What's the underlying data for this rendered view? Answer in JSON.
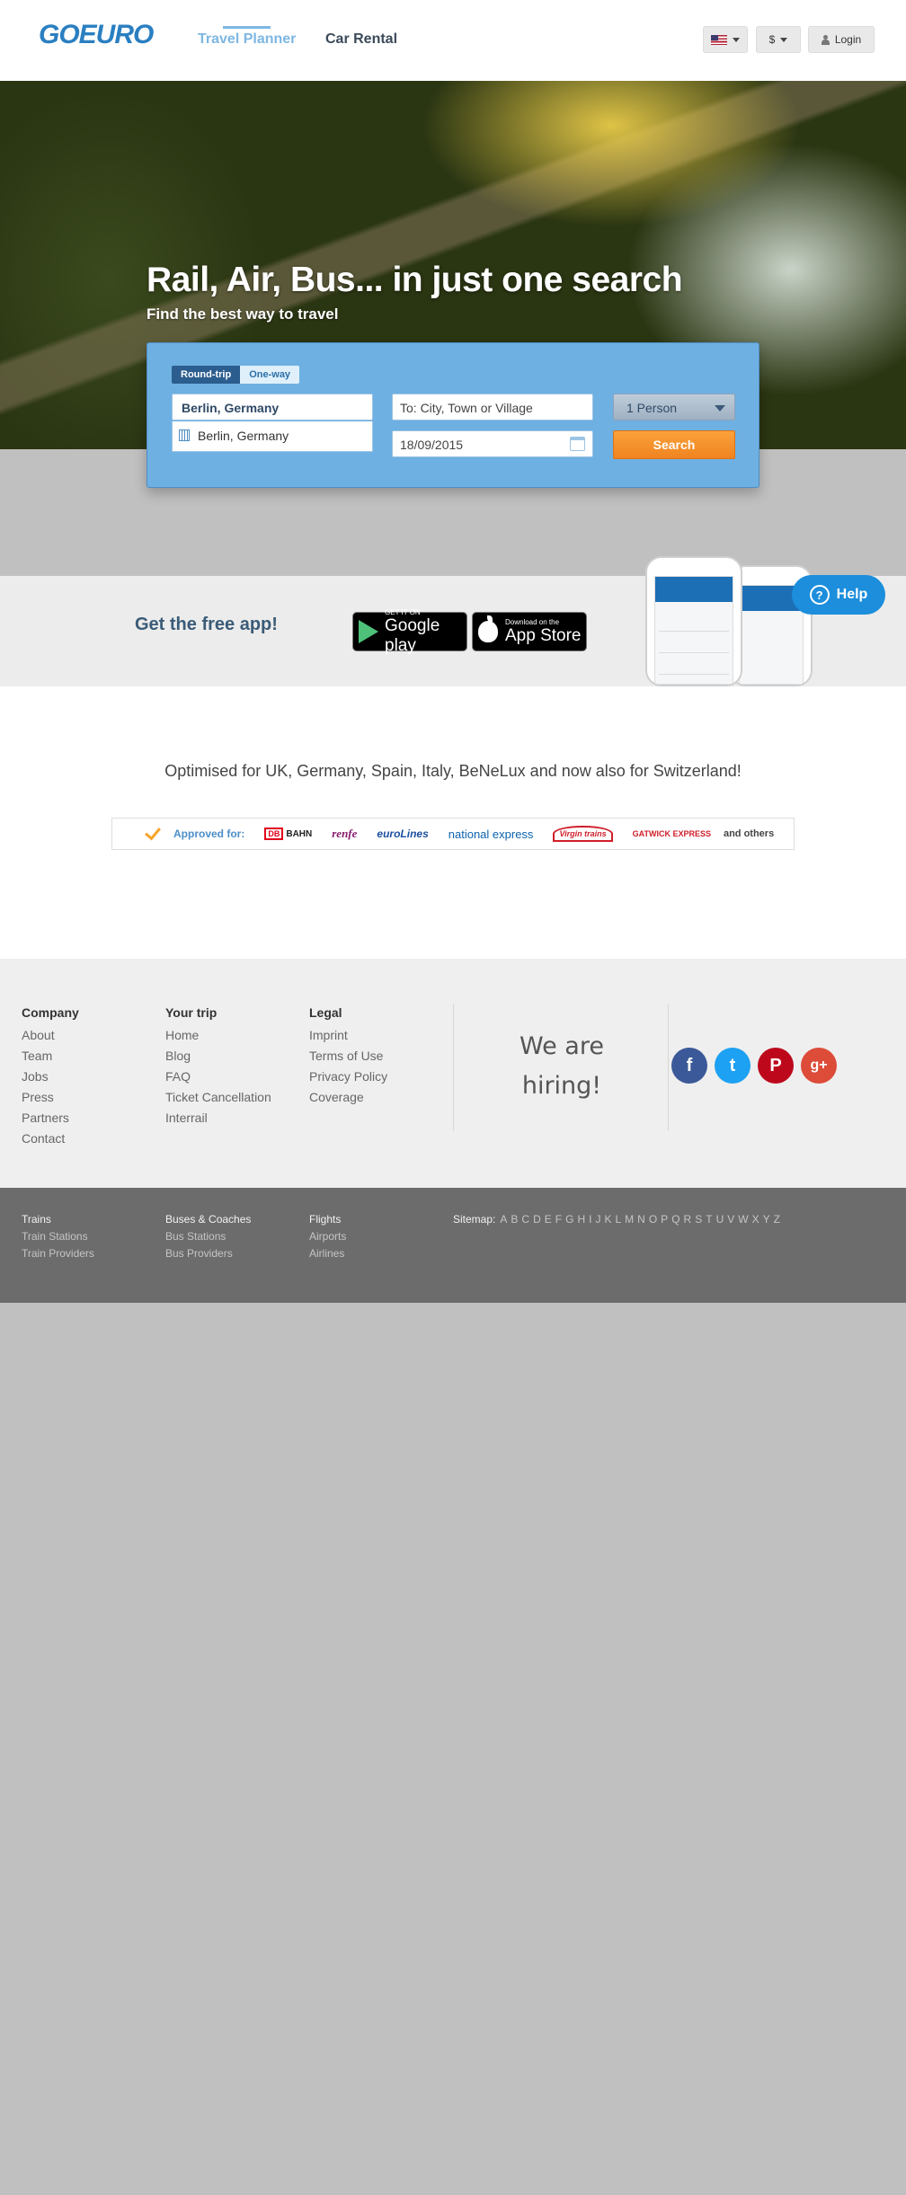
{
  "brand": {
    "logo": "GOEURO"
  },
  "nav": {
    "tabs": [
      {
        "label": "Travel Planner"
      },
      {
        "label": "Car Rental"
      }
    ]
  },
  "header": {
    "currency": "$",
    "login": "Login"
  },
  "hero": {
    "title": "Rail, Air, Bus... in just one search",
    "subtitle": "Find the best way to travel"
  },
  "search": {
    "trip_types": [
      {
        "label": "Round-trip"
      },
      {
        "label": "One-way"
      }
    ],
    "from_value": "Berlin, Germany",
    "suggestion": "Berlin, Germany",
    "to_placeholder": "To: City, Town or Village",
    "date_value": "18/09/2015",
    "persons": "1 Person",
    "search_label": "Search"
  },
  "app": {
    "title": "Get the free app!",
    "google": {
      "small": "GET IT ON",
      "big": "Google play"
    },
    "apple": {
      "small": "Download on the",
      "big": "App Store"
    }
  },
  "help": {
    "label": "Help",
    "glyph": "?"
  },
  "coverage": {
    "text": "Optimised for UK, Germany, Spain, Italy, BeNeLux and now also for Switzerland!",
    "approved_label": "Approved for:",
    "partners": {
      "db_box": "DB",
      "db": "BAHN",
      "renfe": "renfe",
      "eurolines": "euroLines",
      "national": "national express",
      "virgin": "Virgin trains",
      "gatwick": "GATWICK EXPRESS",
      "others": "and others"
    }
  },
  "footer": {
    "company": {
      "head": "Company",
      "links": [
        "About",
        "Team",
        "Jobs",
        "Press",
        "Partners",
        "Contact"
      ]
    },
    "trip": {
      "head": "Your trip",
      "links": [
        "Home",
        "Blog",
        "FAQ",
        "Ticket Cancellation",
        "Interrail"
      ]
    },
    "legal": {
      "head": "Legal",
      "links": [
        "Imprint",
        "Terms of Use",
        "Privacy Policy",
        "Coverage"
      ]
    },
    "hiring": {
      "line1": "We are",
      "line2": "hiring!"
    },
    "social": [
      {
        "name": "facebook",
        "glyph": "f",
        "color": "#3b5998"
      },
      {
        "name": "twitter",
        "glyph": "t",
        "color": "#1da1f2"
      },
      {
        "name": "pinterest",
        "glyph": "P",
        "color": "#bd081c"
      },
      {
        "name": "google-plus",
        "glyph": "g+",
        "color": "#dd4b39"
      }
    ]
  },
  "subfooter": {
    "trains": {
      "head": "Trains",
      "links": [
        "Train Stations",
        "Train Providers"
      ]
    },
    "buses": {
      "head": "Buses & Coaches",
      "links": [
        "Bus Stations",
        "Bus Providers"
      ]
    },
    "flights": {
      "head": "Flights",
      "links": [
        "Airports",
        "Airlines"
      ]
    },
    "sitemap_label": "Sitemap:",
    "letters": [
      "A",
      "B",
      "C",
      "D",
      "E",
      "F",
      "G",
      "H",
      "I",
      "J",
      "K",
      "L",
      "M",
      "N",
      "O",
      "P",
      "Q",
      "R",
      "S",
      "T",
      "U",
      "V",
      "W",
      "X",
      "Y",
      "Z"
    ]
  },
  "colors": {
    "accent": "#2a7fc1",
    "search_button": "#f08420",
    "panel": "#6eb0e2"
  }
}
